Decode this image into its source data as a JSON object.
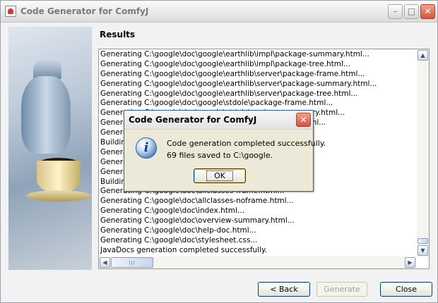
{
  "window": {
    "title": "Code Generator for ComfyJ",
    "controls": {
      "minimize": "–",
      "maximize": "□",
      "close": "✕"
    }
  },
  "results": {
    "label": "Results",
    "lines": [
      "Generating C:\\google\\doc\\google\\earthlib\\impl\\package-summary.html...",
      "Generating C:\\google\\doc\\google\\earthlib\\impl\\package-tree.html...",
      "Generating C:\\google\\doc\\google\\earthlib\\server\\package-frame.html...",
      "Generating C:\\google\\doc\\google\\earthlib\\server\\package-summary.html...",
      "Generating C:\\google\\doc\\google\\earthlib\\server\\package-tree.html...",
      "Generating C:\\google\\doc\\google\\stdole\\package-frame.html...",
      "Generating C:\\google\\doc\\google\\stdole\\package-summary.html...",
      "Generating C:\\google\\doc\\google\\stdole\\package-tree.html...",
      "Generating C:\\google\\doc\\constant-values.html...",
      "Building index for all the packages and classes...",
      "Generating C:\\google\\doc\\overview-tree.html...",
      "Generating C:\\google\\doc\\index-all.html...",
      "Generating C:\\google\\doc\\deprecated-list.html...",
      "Building index for all classes...",
      "Generating C:\\google\\doc\\allclasses-frame.html...",
      "Generating C:\\google\\doc\\allclasses-noframe.html...",
      "Generating C:\\google\\doc\\index.html...",
      "Generating C:\\google\\doc\\overview-summary.html...",
      "Generating C:\\google\\doc\\help-doc.html...",
      "Generating C:\\google\\doc\\stylesheet.css...",
      "JavaDocs generation completed successfully."
    ]
  },
  "buttons": {
    "back": "< Back",
    "generate": "Generate",
    "close": "Close"
  },
  "dialog": {
    "title": "Code Generator for ComfyJ",
    "close": "✕",
    "icon_glyph": "i",
    "message_line1": "Code generation completed successfully.",
    "message_line2": "69 files saved to C:\\google.",
    "ok": "OK"
  },
  "scrollbars": {
    "up": "▲",
    "down": "▼",
    "left": "◀",
    "right": "▶"
  }
}
